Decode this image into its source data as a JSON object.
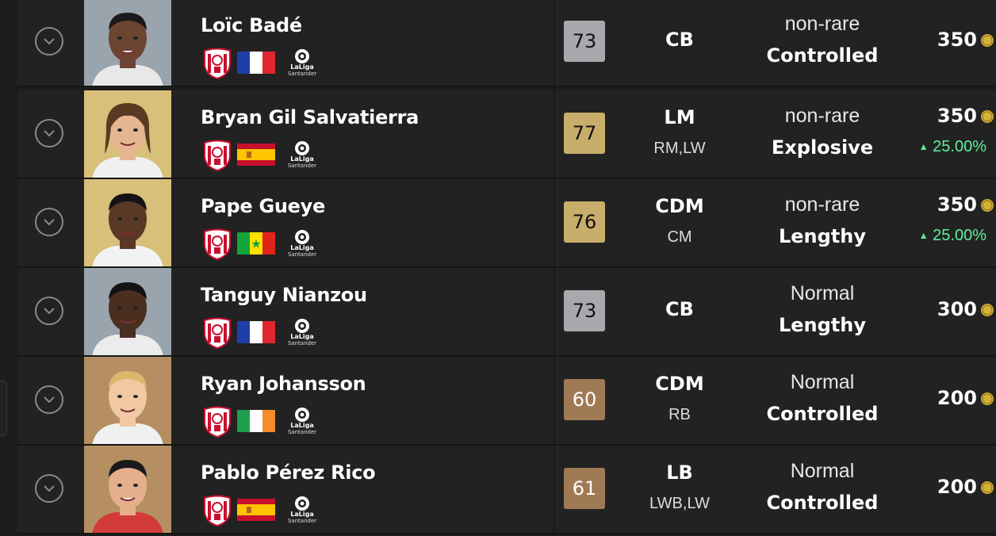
{
  "colors": {
    "background": "#1c1c1c",
    "row": "#222222",
    "silver": "#a7a9ac",
    "gold": "#c9ad6b",
    "bronze": "#a07a55",
    "positive": "#5ff09a",
    "coin": "#d4b13a"
  },
  "icons": {
    "expand": "chevron-down-circle-icon",
    "club": "sevilla-crest-icon",
    "league": "laliga-logo-icon",
    "coin": "fut-coin-icon",
    "change": "triangle-up-icon"
  },
  "league_logo": {
    "line1": "LaLiga",
    "line2": "Santander"
  },
  "coin_label": "FUT",
  "players": [
    {
      "name": "Loïc Badé",
      "rating": "73",
      "tier": "silver",
      "position": "CB",
      "alt_positions": "",
      "rarity": "non-rare",
      "accelerate": "Controlled",
      "price": "350",
      "change": "",
      "nation": "France"
    },
    {
      "name": "Bryan Gil Salvatierra",
      "rating": "77",
      "tier": "gold",
      "position": "LM",
      "alt_positions": "RM,LW",
      "rarity": "non-rare",
      "accelerate": "Explosive",
      "price": "350",
      "change": "25.00%",
      "nation": "Spain"
    },
    {
      "name": "Pape Gueye",
      "rating": "76",
      "tier": "gold",
      "position": "CDM",
      "alt_positions": "CM",
      "rarity": "non-rare",
      "accelerate": "Lengthy",
      "price": "350",
      "change": "25.00%",
      "nation": "Senegal"
    },
    {
      "name": "Tanguy Nianzou",
      "rating": "73",
      "tier": "silver",
      "position": "CB",
      "alt_positions": "",
      "rarity": "Normal",
      "accelerate": "Lengthy",
      "price": "300",
      "change": "",
      "nation": "France"
    },
    {
      "name": "Ryan Johansson",
      "rating": "60",
      "tier": "bronze",
      "position": "CDM",
      "alt_positions": "RB",
      "rarity": "Normal",
      "accelerate": "Controlled",
      "price": "200",
      "change": "",
      "nation": "Ireland"
    },
    {
      "name": "Pablo Pérez Rico",
      "rating": "61",
      "tier": "bronze",
      "position": "LB",
      "alt_positions": "LWB,LW",
      "rarity": "Normal",
      "accelerate": "Controlled",
      "price": "200",
      "change": "",
      "nation": "Spain"
    }
  ]
}
